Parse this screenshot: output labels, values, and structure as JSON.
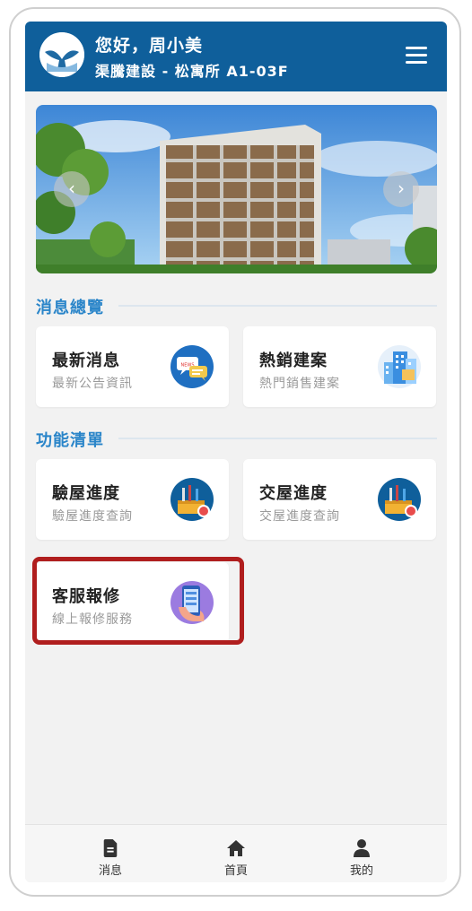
{
  "header": {
    "greeting": "您好，周小美",
    "project": "渠騰建設 - 松寓所 A1-03F",
    "logo_icon": "whale-tail-logo",
    "menu_icon": "hamburger-menu-icon",
    "color": "#0f5f9b"
  },
  "banner": {
    "prev_icon": "chevron-left-icon",
    "next_icon": "chevron-right-icon",
    "prev_glyph": "‹",
    "next_glyph": "›"
  },
  "sections": {
    "news": {
      "title": "消息總覽"
    },
    "functions": {
      "title": "功能清單"
    }
  },
  "cards": {
    "latest_news": {
      "title": "最新消息",
      "subtitle": "最新公告資訊",
      "icon": "news-chat-icon"
    },
    "hot_projects": {
      "title": "熱銷建案",
      "subtitle": "熱門銷售建案",
      "icon": "buildings-icon"
    },
    "inspection": {
      "title": "驗屋進度",
      "subtitle": "驗屋進度查詢",
      "icon": "toolbox-icon"
    },
    "handover": {
      "title": "交屋進度",
      "subtitle": "交屋進度查詢",
      "icon": "toolbox-icon"
    },
    "repair": {
      "title": "客服報修",
      "subtitle": "線上報修服務",
      "icon": "phone-in-hand-icon"
    }
  },
  "bottom_nav": [
    {
      "label": "消息",
      "icon": "document-icon"
    },
    {
      "label": "首頁",
      "icon": "home-icon"
    },
    {
      "label": "我的",
      "icon": "user-icon"
    }
  ],
  "accent_color": "#2a85c9",
  "highlight_color": "#b01e1e"
}
